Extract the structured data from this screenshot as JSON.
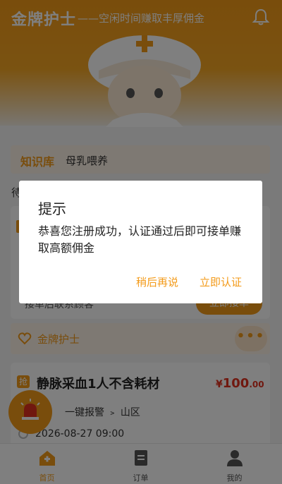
{
  "header": {
    "brand": "金牌护士",
    "slogan": "——空闲时间赚取丰厚佣金",
    "bell_icon": "bell-icon"
  },
  "knowledge": {
    "tag": "知识库",
    "text": "母乳喂养"
  },
  "section_label": "待",
  "card1": {
    "hint": "接单后联系顾客",
    "accept_label": "立即接单"
  },
  "shop": {
    "name": "金牌护士",
    "more": "•••"
  },
  "order": {
    "badge": "抢",
    "title": "静脉采血1人不含耗材",
    "currency": "¥",
    "price_int": "100",
    "price_dec": ".00",
    "route": "一键报警 ﹥ 山区",
    "datetime": "2026-08-27  09:00"
  },
  "tabs": [
    {
      "label": "首页"
    },
    {
      "label": "订单"
    },
    {
      "label": "我的"
    }
  ],
  "dialog": {
    "title": "提示",
    "message": "恭喜您注册成功，认证通过后即可接单赚取高额佣金",
    "later_label": "稍后再说",
    "now_label": "立即认证"
  },
  "colors": {
    "accent": "#f39a18",
    "price": "#e0301e",
    "overlay": "rgba(0,0,0,0.5)"
  }
}
